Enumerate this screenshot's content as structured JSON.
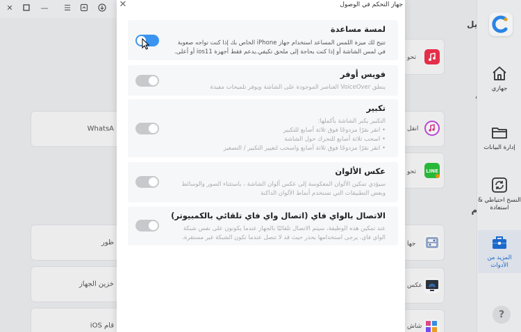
{
  "window_controls": [
    "close-icon",
    "maximize-icon",
    "minimize-icon",
    "menu-icon",
    "feedback-icon",
    "download-icon"
  ],
  "background": {
    "sections": {
      "transfer": "تحويل",
      "move": "نقل",
      "system": "نظام"
    },
    "left_cards": [
      {
        "text": "WhatsA"
      },
      {
        "text": "ظور"
      },
      {
        "text": "خزين الجهاز"
      },
      {
        "text": "قام iOS"
      }
    ],
    "tiles": [
      {
        "icon": "music-app-icon",
        "color": "#f2314c",
        "text": "تحو"
      },
      {
        "icon": "itunes-icon",
        "color": "#ffffff",
        "text": "انقل"
      },
      {
        "icon": "line-app-icon",
        "color": "#2bc23d",
        "text": "تحو"
      },
      {
        "icon": "toggle-settings-icon",
        "color": "#ffffff",
        "text": "جها"
      },
      {
        "icon": "screen-mirror-icon",
        "color": "#ffffff",
        "text": "عكس"
      },
      {
        "icon": "app-grid-icon",
        "color": "#ffffff",
        "text": "شاش"
      }
    ]
  },
  "sidebar": {
    "items": [
      {
        "icon": "home-icon",
        "label": "جهازي",
        "active": false
      },
      {
        "icon": "folder-icon",
        "label": "إدارة البيانات",
        "active": false
      },
      {
        "icon": "backup-restore-icon",
        "label": "النسخ احتياطي & استعادة",
        "active": false
      },
      {
        "icon": "toolbox-icon",
        "label": "المزيد من الأدوات",
        "active": true
      }
    ],
    "help_label": "?"
  },
  "modal": {
    "title": "جهاز التحكم في الوصول",
    "features": [
      {
        "title": "لمسة مساعدة",
        "desc": [
          "تتيح لك ميزة اللمس المساعد استخدام جهاز iPhone الخاص بك إذا كنت تواجه صعوبة",
          "في لمس الشاشة أو إذا كنت بحاجة إلى ملحق تكيفي.يدعم فقط أجهزة ios11 أو أعلى."
        ],
        "enabled": true,
        "muted": false
      },
      {
        "title": "فويس أوفر",
        "desc": [
          "ينطق VoiceOver العناصر الموجودة على الشاشة ويوفر تلميحات مفيدة"
        ],
        "enabled": false,
        "muted": true
      },
      {
        "title": "تكبير",
        "desc": [
          "التكبير يكبر الشاشة بأكملها:",
          "• انقر نقرًا مزدوجًا فوق ثلاثة أصابع للتكبير",
          "• اسحب ثلاثة أصابع للتحرك حول الشاشة",
          "• انقر نقرًا مزدوجًا فوق ثلاثة أصابع واسحب لتغيير التكبير / التصغير"
        ],
        "enabled": false,
        "muted": true
      },
      {
        "title": "عكس الألوان",
        "desc": [
          "سيؤدي تمكين الألوان المعكوسة إلى عكس ألوان الشاشة ، باستثناء الصور والوسائط",
          "وبعض التطبيقات التي تستخدم أنماط الألوان الداكنة"
        ],
        "enabled": false,
        "muted": true
      },
      {
        "title": "الاتصال بالواي فاي (اتصال واي فاي تلقائي بالكمبيوتر)",
        "desc": [
          "عند تمكين هذه الوظيفة، سيتم الاتصال تلقائيًا بالجهاز عندما يكونون على نفس شبكة",
          "الواي فاي. يرجى استخدامها بحذر حيث قد لا تتصل عندما تكون الشبكة غير مستقرة."
        ],
        "enabled": false,
        "muted": true
      }
    ]
  },
  "colors": {
    "accent": "#3b94f0",
    "toggle_off": "#c8c9cc",
    "active_nav": "#1c6fd6"
  }
}
